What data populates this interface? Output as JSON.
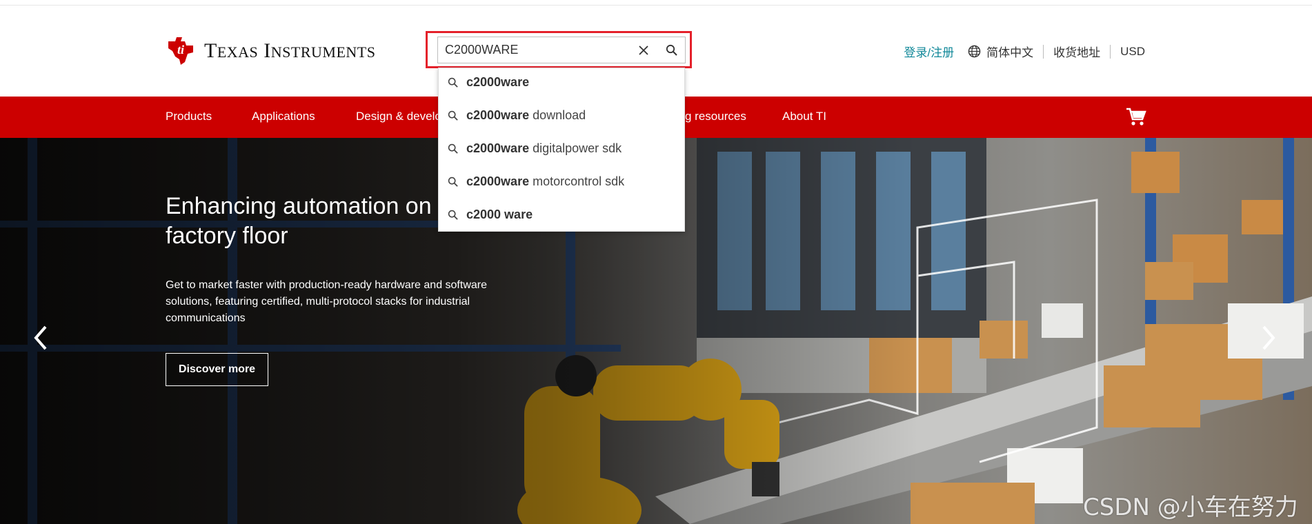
{
  "header": {
    "logo_text_cap1": "T",
    "logo_text_rest1": "EXAS",
    "logo_text_cap2": "I",
    "logo_text_rest2": "NSTRUMENTS",
    "search_value": "C2000WARE",
    "login_label": "登录/注册",
    "language_label": "简体中文",
    "address_label": "收货地址",
    "currency_label": "USD"
  },
  "search_suggestions": [
    {
      "bold": "c2000ware",
      "rest": ""
    },
    {
      "bold": "c2000ware",
      "rest": " download"
    },
    {
      "bold": "c2000ware",
      "rest": " digitalpower sdk"
    },
    {
      "bold": "c2000ware",
      "rest": " motorcontrol sdk"
    },
    {
      "bold": "c2000 ware",
      "rest": ""
    }
  ],
  "nav": {
    "items": [
      "Products",
      "Applications",
      "Design & development",
      "Ordering resources",
      "About TI"
    ],
    "visible_item_3": "Design & develo",
    "visible_item_4": "g resources"
  },
  "hero": {
    "title": "Enhancing automation on the factory floor",
    "title_line1": "Enhancing automation on t",
    "title_line2": "factory floor",
    "description": "Get to market faster with production-ready hardware and software solutions, featuring certified, multi-protocol stacks for industrial communications",
    "button_label": "Discover more"
  },
  "watermark": "CSDN @小车在努力",
  "colors": {
    "brand_red": "#cc0000",
    "highlight_red": "#e4202a",
    "login_teal": "#118899"
  },
  "icons": {
    "search": "search-icon",
    "clear": "close-icon",
    "globe": "globe-icon",
    "cart": "cart-icon",
    "prev": "chevron-left-icon",
    "next": "chevron-right-icon"
  }
}
